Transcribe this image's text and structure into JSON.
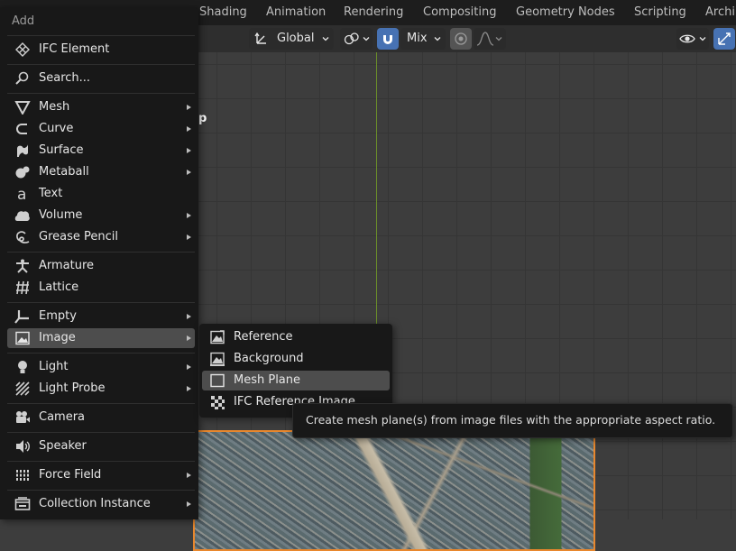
{
  "workspace_tabs": [
    "Shading",
    "Animation",
    "Rendering",
    "Compositing",
    "Geometry Nodes",
    "Scripting",
    "Archi"
  ],
  "viewport_header": {
    "transform_orientation": "Global",
    "snap_target": "Mix",
    "icons": [
      "orientation-icon",
      "pivot-icon",
      "snap-icon",
      "proportional-editing-icon",
      "falloff-icon",
      "visibility-icon",
      "gizmo-icon"
    ]
  },
  "viewport": {
    "overlay_text": "p",
    "accent_colors": {
      "y_axis": "#6b8f2a",
      "selection_outline": "#e8872d",
      "active_button": "#4772b3"
    }
  },
  "add_menu": {
    "title": "Add",
    "items": [
      {
        "label": "IFC Element",
        "icon": "ifc-element-icon",
        "submenu": false
      },
      {
        "label": "Search...",
        "icon": "search-icon",
        "submenu": false
      },
      {
        "label": "Mesh",
        "icon": "mesh-icon",
        "submenu": true
      },
      {
        "label": "Curve",
        "icon": "curve-icon",
        "submenu": true
      },
      {
        "label": "Surface",
        "icon": "surface-icon",
        "submenu": true
      },
      {
        "label": "Metaball",
        "icon": "metaball-icon",
        "submenu": true
      },
      {
        "label": "Text",
        "icon": "text-icon",
        "submenu": false
      },
      {
        "label": "Volume",
        "icon": "volume-icon",
        "submenu": true
      },
      {
        "label": "Grease Pencil",
        "icon": "grease-pencil-icon",
        "submenu": true
      },
      {
        "label": "Armature",
        "icon": "armature-icon",
        "submenu": false
      },
      {
        "label": "Lattice",
        "icon": "lattice-icon",
        "submenu": false
      },
      {
        "label": "Empty",
        "icon": "empty-icon",
        "submenu": true
      },
      {
        "label": "Image",
        "icon": "image-icon",
        "submenu": true,
        "active": true
      },
      {
        "label": "Light",
        "icon": "light-icon",
        "submenu": true
      },
      {
        "label": "Light Probe",
        "icon": "light-probe-icon",
        "submenu": true
      },
      {
        "label": "Camera",
        "icon": "camera-icon",
        "submenu": false
      },
      {
        "label": "Speaker",
        "icon": "speaker-icon",
        "submenu": false
      },
      {
        "label": "Force Field",
        "icon": "force-field-icon",
        "submenu": true
      },
      {
        "label": "Collection Instance",
        "icon": "collection-instance-icon",
        "submenu": true
      }
    ]
  },
  "image_submenu": {
    "items": [
      {
        "label": "Reference",
        "icon": "image-reference-icon"
      },
      {
        "label": "Background",
        "icon": "image-background-icon"
      },
      {
        "label": "Mesh Plane",
        "icon": "mesh-plane-icon",
        "active": true
      },
      {
        "label": "IFC Reference Image",
        "icon": "ifc-reference-image-icon"
      }
    ]
  },
  "tooltip": {
    "text": "Create mesh plane(s) from image files with the appropriate aspect ratio."
  }
}
